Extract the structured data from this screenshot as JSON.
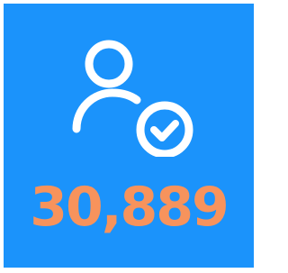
{
  "stat": {
    "value": "30,889",
    "color": "#f7935c"
  },
  "icon": {
    "name": "user-check-icon",
    "color": "#ffffff"
  },
  "background_color": "#1b93fb"
}
